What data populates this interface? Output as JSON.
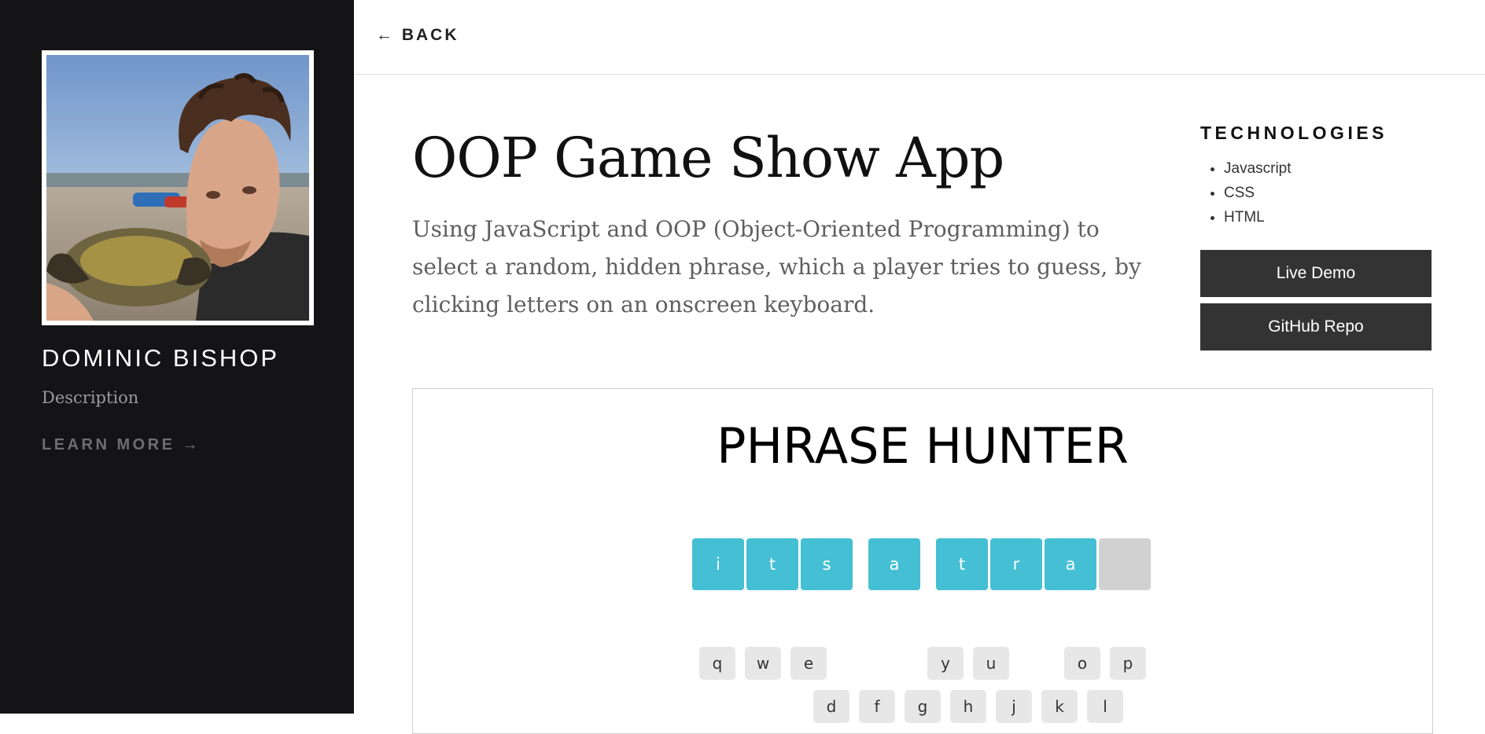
{
  "sidebar": {
    "name": "DOMINIC BISHOP",
    "description": "Description",
    "learn_more": "LEARN MORE →"
  },
  "topbar": {
    "back_label": "← BACK"
  },
  "project": {
    "title": "OOP Game Show App",
    "summary": "Using JavaScript and OOP (Object-Oriented Programming) to select a random, hidden phrase, which a player tries to guess, by clicking letters on an onscreen keyboard.",
    "technologies_heading": "TECHNOLOGIES",
    "technologies": [
      "Javascript",
      "CSS",
      "HTML"
    ],
    "live_demo": "Live Demo",
    "github_repo": "GitHub Repo"
  },
  "game": {
    "title": "PHRASE HUNTER",
    "phrase_tiles": [
      {
        "letter": "i",
        "state": "shown"
      },
      {
        "letter": "t",
        "state": "shown"
      },
      {
        "letter": "s",
        "state": "shown"
      },
      {
        "letter": " ",
        "state": "space"
      },
      {
        "letter": "a",
        "state": "shown"
      },
      {
        "letter": " ",
        "state": "space"
      },
      {
        "letter": "t",
        "state": "shown"
      },
      {
        "letter": "r",
        "state": "shown"
      },
      {
        "letter": "a",
        "state": "shown"
      },
      {
        "letter": "",
        "state": "hidden"
      }
    ],
    "keyboard_row1": [
      {
        "key": "q",
        "visible": true
      },
      {
        "key": "w",
        "visible": true
      },
      {
        "key": "e",
        "visible": true
      },
      {
        "key": "r",
        "visible": false
      },
      {
        "key": "t",
        "visible": false
      },
      {
        "key": "y",
        "visible": true
      },
      {
        "key": "u",
        "visible": true
      },
      {
        "key": "i",
        "visible": false
      },
      {
        "key": "o",
        "visible": true
      },
      {
        "key": "p",
        "visible": true
      }
    ],
    "keyboard_row2": [
      {
        "key": "a",
        "visible": false
      },
      {
        "key": "s",
        "visible": false
      },
      {
        "key": "d",
        "visible": true
      },
      {
        "key": "f",
        "visible": true
      },
      {
        "key": "g",
        "visible": true
      },
      {
        "key": "h",
        "visible": true
      },
      {
        "key": "j",
        "visible": true
      },
      {
        "key": "k",
        "visible": true
      },
      {
        "key": "l",
        "visible": true
      }
    ]
  }
}
